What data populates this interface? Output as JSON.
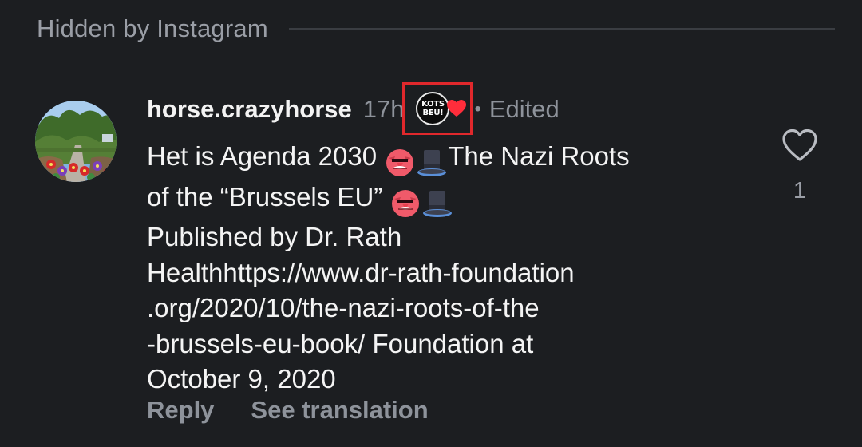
{
  "section": {
    "hidden_label": "Hidden by Instagram"
  },
  "comment": {
    "username": "horse.crazyhorse",
    "time": "17h",
    "badge_text_line1": "KOTS",
    "badge_text_line2": "BEU!",
    "separator": "•",
    "edited": "Edited",
    "text_parts": {
      "line1a": "Het is Agenda 2030 ",
      "line1b": "The Nazi Roots",
      "line2a": "of the “Brussels EU” ",
      "rest": "Published by Dr. Rath\nHealthhttps://www.dr-rath-foundation\n.org/2020/10/the-nazi-roots-of-the\n-brussels-eu-book/ Foundation at\nOctober 9, 2020"
    },
    "emoji_names": [
      "goblin-emoji",
      "top-hat-emoji"
    ],
    "like_count": "1"
  },
  "actions": {
    "reply": "Reply",
    "see_translation": "See translation"
  },
  "colors": {
    "background": "#1c1e21",
    "primary_text": "#f4f4f4",
    "secondary_text": "#8e939b",
    "highlight_box": "#e0282c",
    "badge_heart": "#ff2d3b"
  }
}
